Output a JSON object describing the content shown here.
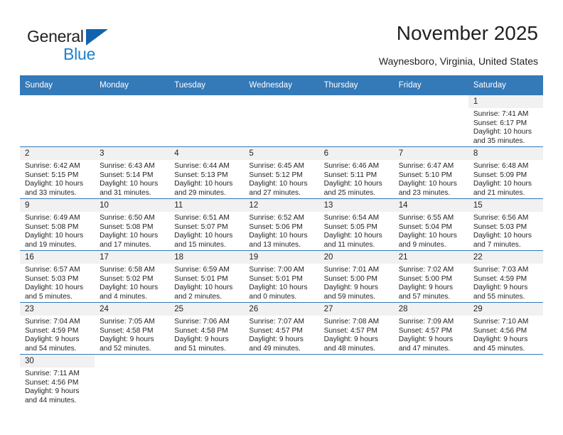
{
  "brand": {
    "name_part1": "General",
    "name_part2": "Blue",
    "triangle_color": "#1263ad",
    "blue_color": "#1d81cd"
  },
  "header": {
    "title": "November 2025",
    "subtitle": "Waynesboro, Virginia, United States"
  },
  "theme": {
    "header_row_bg": "#3479b8",
    "daynum_band_bg": "#f1f1f1",
    "grid_line": "#3479b8",
    "text": "#231f20"
  },
  "weekday_headers": [
    "Sunday",
    "Monday",
    "Tuesday",
    "Wednesday",
    "Thursday",
    "Friday",
    "Saturday"
  ],
  "weeks": [
    [
      {
        "day": "",
        "blank": true,
        "lines": [
          "",
          "",
          "",
          ""
        ]
      },
      {
        "day": "",
        "blank": true,
        "lines": [
          "",
          "",
          "",
          ""
        ]
      },
      {
        "day": "",
        "blank": true,
        "lines": [
          "",
          "",
          "",
          ""
        ]
      },
      {
        "day": "",
        "blank": true,
        "lines": [
          "",
          "",
          "",
          ""
        ]
      },
      {
        "day": "",
        "blank": true,
        "lines": [
          "",
          "",
          "",
          ""
        ]
      },
      {
        "day": "",
        "blank": true,
        "lines": [
          "",
          "",
          "",
          ""
        ]
      },
      {
        "day": "1",
        "lines": [
          "Sunrise: 7:41 AM",
          "Sunset: 6:17 PM",
          "Daylight: 10 hours",
          "and 35 minutes."
        ]
      }
    ],
    [
      {
        "day": "2",
        "lines": [
          "Sunrise: 6:42 AM",
          "Sunset: 5:15 PM",
          "Daylight: 10 hours",
          "and 33 minutes."
        ]
      },
      {
        "day": "3",
        "lines": [
          "Sunrise: 6:43 AM",
          "Sunset: 5:14 PM",
          "Daylight: 10 hours",
          "and 31 minutes."
        ]
      },
      {
        "day": "4",
        "lines": [
          "Sunrise: 6:44 AM",
          "Sunset: 5:13 PM",
          "Daylight: 10 hours",
          "and 29 minutes."
        ]
      },
      {
        "day": "5",
        "lines": [
          "Sunrise: 6:45 AM",
          "Sunset: 5:12 PM",
          "Daylight: 10 hours",
          "and 27 minutes."
        ]
      },
      {
        "day": "6",
        "lines": [
          "Sunrise: 6:46 AM",
          "Sunset: 5:11 PM",
          "Daylight: 10 hours",
          "and 25 minutes."
        ]
      },
      {
        "day": "7",
        "lines": [
          "Sunrise: 6:47 AM",
          "Sunset: 5:10 PM",
          "Daylight: 10 hours",
          "and 23 minutes."
        ]
      },
      {
        "day": "8",
        "lines": [
          "Sunrise: 6:48 AM",
          "Sunset: 5:09 PM",
          "Daylight: 10 hours",
          "and 21 minutes."
        ]
      }
    ],
    [
      {
        "day": "9",
        "lines": [
          "Sunrise: 6:49 AM",
          "Sunset: 5:08 PM",
          "Daylight: 10 hours",
          "and 19 minutes."
        ]
      },
      {
        "day": "10",
        "lines": [
          "Sunrise: 6:50 AM",
          "Sunset: 5:08 PM",
          "Daylight: 10 hours",
          "and 17 minutes."
        ]
      },
      {
        "day": "11",
        "lines": [
          "Sunrise: 6:51 AM",
          "Sunset: 5:07 PM",
          "Daylight: 10 hours",
          "and 15 minutes."
        ]
      },
      {
        "day": "12",
        "lines": [
          "Sunrise: 6:52 AM",
          "Sunset: 5:06 PM",
          "Daylight: 10 hours",
          "and 13 minutes."
        ]
      },
      {
        "day": "13",
        "lines": [
          "Sunrise: 6:54 AM",
          "Sunset: 5:05 PM",
          "Daylight: 10 hours",
          "and 11 minutes."
        ]
      },
      {
        "day": "14",
        "lines": [
          "Sunrise: 6:55 AM",
          "Sunset: 5:04 PM",
          "Daylight: 10 hours",
          "and 9 minutes."
        ]
      },
      {
        "day": "15",
        "lines": [
          "Sunrise: 6:56 AM",
          "Sunset: 5:03 PM",
          "Daylight: 10 hours",
          "and 7 minutes."
        ]
      }
    ],
    [
      {
        "day": "16",
        "lines": [
          "Sunrise: 6:57 AM",
          "Sunset: 5:03 PM",
          "Daylight: 10 hours",
          "and 5 minutes."
        ]
      },
      {
        "day": "17",
        "lines": [
          "Sunrise: 6:58 AM",
          "Sunset: 5:02 PM",
          "Daylight: 10 hours",
          "and 4 minutes."
        ]
      },
      {
        "day": "18",
        "lines": [
          "Sunrise: 6:59 AM",
          "Sunset: 5:01 PM",
          "Daylight: 10 hours",
          "and 2 minutes."
        ]
      },
      {
        "day": "19",
        "lines": [
          "Sunrise: 7:00 AM",
          "Sunset: 5:01 PM",
          "Daylight: 10 hours",
          "and 0 minutes."
        ]
      },
      {
        "day": "20",
        "lines": [
          "Sunrise: 7:01 AM",
          "Sunset: 5:00 PM",
          "Daylight: 9 hours",
          "and 59 minutes."
        ]
      },
      {
        "day": "21",
        "lines": [
          "Sunrise: 7:02 AM",
          "Sunset: 5:00 PM",
          "Daylight: 9 hours",
          "and 57 minutes."
        ]
      },
      {
        "day": "22",
        "lines": [
          "Sunrise: 7:03 AM",
          "Sunset: 4:59 PM",
          "Daylight: 9 hours",
          "and 55 minutes."
        ]
      }
    ],
    [
      {
        "day": "23",
        "lines": [
          "Sunrise: 7:04 AM",
          "Sunset: 4:59 PM",
          "Daylight: 9 hours",
          "and 54 minutes."
        ]
      },
      {
        "day": "24",
        "lines": [
          "Sunrise: 7:05 AM",
          "Sunset: 4:58 PM",
          "Daylight: 9 hours",
          "and 52 minutes."
        ]
      },
      {
        "day": "25",
        "lines": [
          "Sunrise: 7:06 AM",
          "Sunset: 4:58 PM",
          "Daylight: 9 hours",
          "and 51 minutes."
        ]
      },
      {
        "day": "26",
        "lines": [
          "Sunrise: 7:07 AM",
          "Sunset: 4:57 PM",
          "Daylight: 9 hours",
          "and 49 minutes."
        ]
      },
      {
        "day": "27",
        "lines": [
          "Sunrise: 7:08 AM",
          "Sunset: 4:57 PM",
          "Daylight: 9 hours",
          "and 48 minutes."
        ]
      },
      {
        "day": "28",
        "lines": [
          "Sunrise: 7:09 AM",
          "Sunset: 4:57 PM",
          "Daylight: 9 hours",
          "and 47 minutes."
        ]
      },
      {
        "day": "29",
        "lines": [
          "Sunrise: 7:10 AM",
          "Sunset: 4:56 PM",
          "Daylight: 9 hours",
          "and 45 minutes."
        ]
      }
    ],
    [
      {
        "day": "30",
        "lines": [
          "Sunrise: 7:11 AM",
          "Sunset: 4:56 PM",
          "Daylight: 9 hours",
          "and 44 minutes."
        ]
      },
      {
        "day": "",
        "blank": true,
        "lines": [
          "",
          "",
          "",
          ""
        ]
      },
      {
        "day": "",
        "blank": true,
        "lines": [
          "",
          "",
          "",
          ""
        ]
      },
      {
        "day": "",
        "blank": true,
        "lines": [
          "",
          "",
          "",
          ""
        ]
      },
      {
        "day": "",
        "blank": true,
        "lines": [
          "",
          "",
          "",
          ""
        ]
      },
      {
        "day": "",
        "blank": true,
        "lines": [
          "",
          "",
          "",
          ""
        ]
      },
      {
        "day": "",
        "blank": true,
        "lines": [
          "",
          "",
          "",
          ""
        ]
      }
    ]
  ]
}
